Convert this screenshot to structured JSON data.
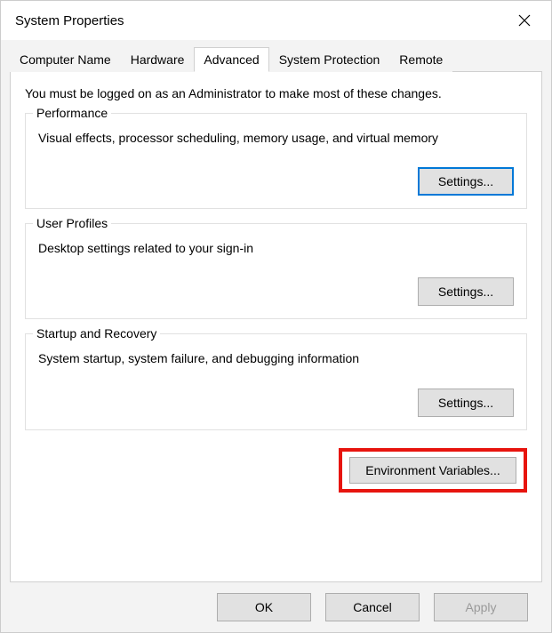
{
  "title": "System Properties",
  "tabs": [
    {
      "label": "Computer Name"
    },
    {
      "label": "Hardware"
    },
    {
      "label": "Advanced"
    },
    {
      "label": "System Protection"
    },
    {
      "label": "Remote"
    }
  ],
  "intro": "You must be logged on as an Administrator to make most of these changes.",
  "groups": {
    "performance": {
      "label": "Performance",
      "desc": "Visual effects, processor scheduling, memory usage, and virtual memory",
      "button": "Settings..."
    },
    "profiles": {
      "label": "User Profiles",
      "desc": "Desktop settings related to your sign-in",
      "button": "Settings..."
    },
    "startup": {
      "label": "Startup and Recovery",
      "desc": "System startup, system failure, and debugging information",
      "button": "Settings..."
    }
  },
  "env_button": "Environment Variables...",
  "footer": {
    "ok": "OK",
    "cancel": "Cancel",
    "apply": "Apply"
  }
}
